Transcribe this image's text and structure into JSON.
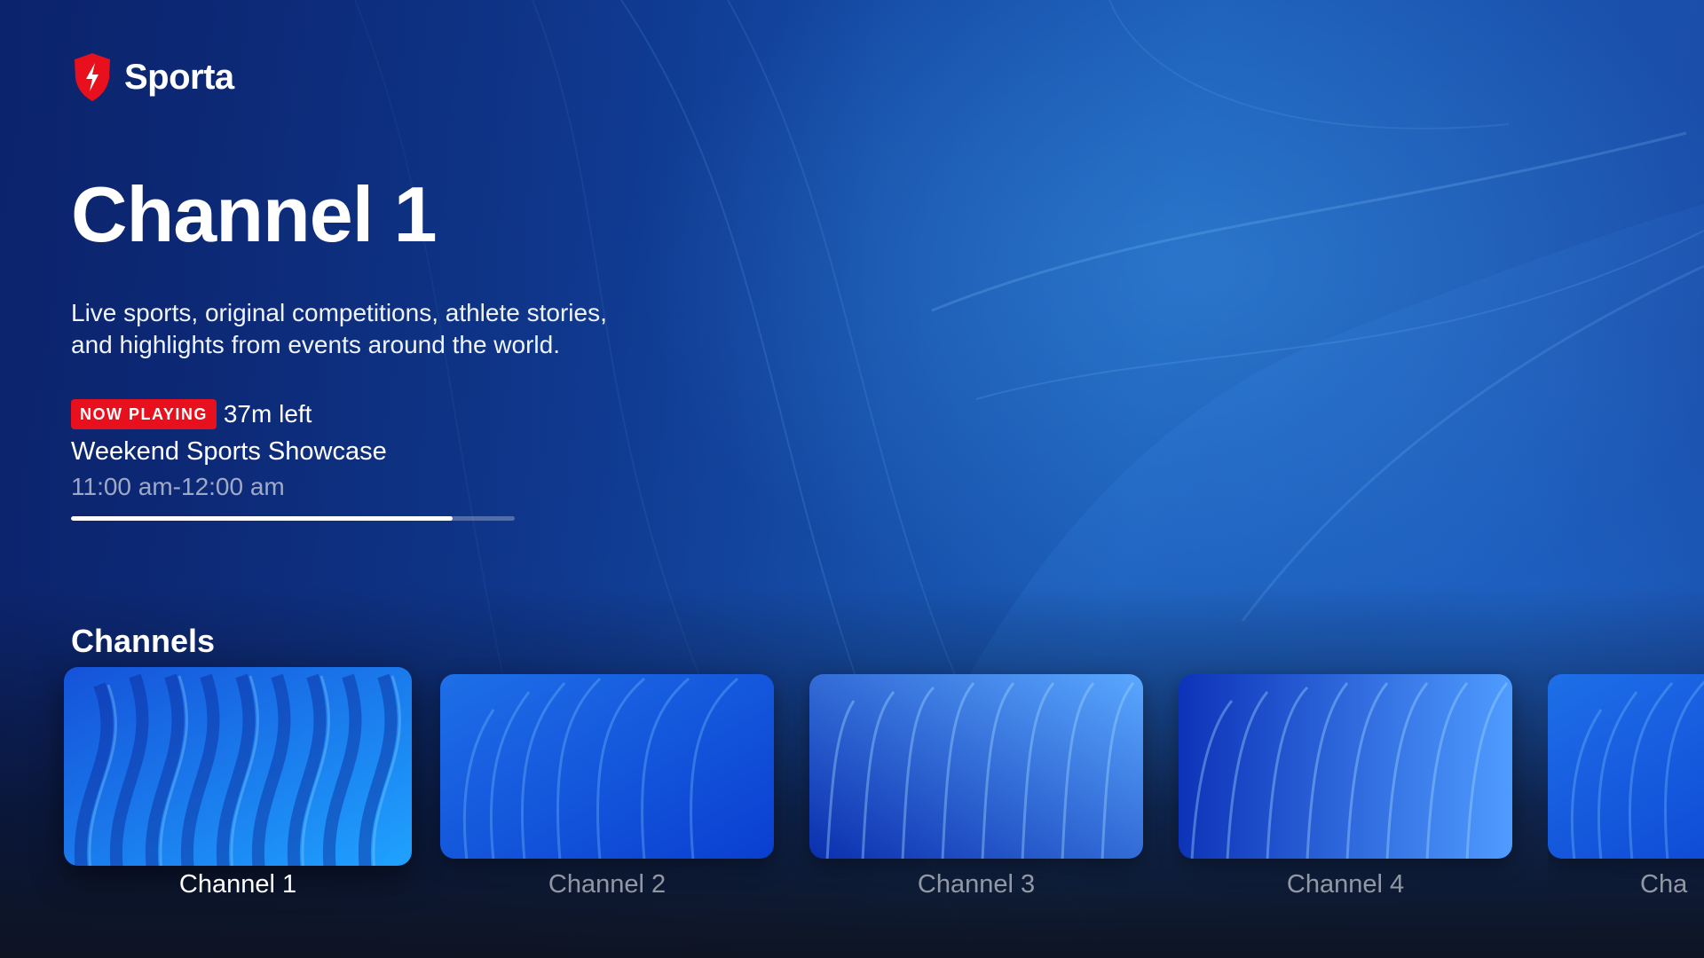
{
  "brand": {
    "name": "Sporta",
    "icon": "bolt-shield-icon",
    "accent_color": "#e8101d"
  },
  "hero": {
    "title": "Channel 1",
    "description": "Live sports, original competitions, athlete stories, and highlights from events around the world.",
    "status_badge": "NOW PLAYING",
    "time_left": "37m left",
    "program_title": "Weekend Sports Showcase",
    "program_time": "11:00 am-12:00 am",
    "progress": 0.86
  },
  "channels": {
    "title": "Channels",
    "items": [
      {
        "label": "Channel 1",
        "focused": true
      },
      {
        "label": "Channel 2",
        "focused": false
      },
      {
        "label": "Channel 3",
        "focused": false
      },
      {
        "label": "Channel 4",
        "focused": false
      },
      {
        "label": "Cha",
        "focused": false
      }
    ]
  }
}
